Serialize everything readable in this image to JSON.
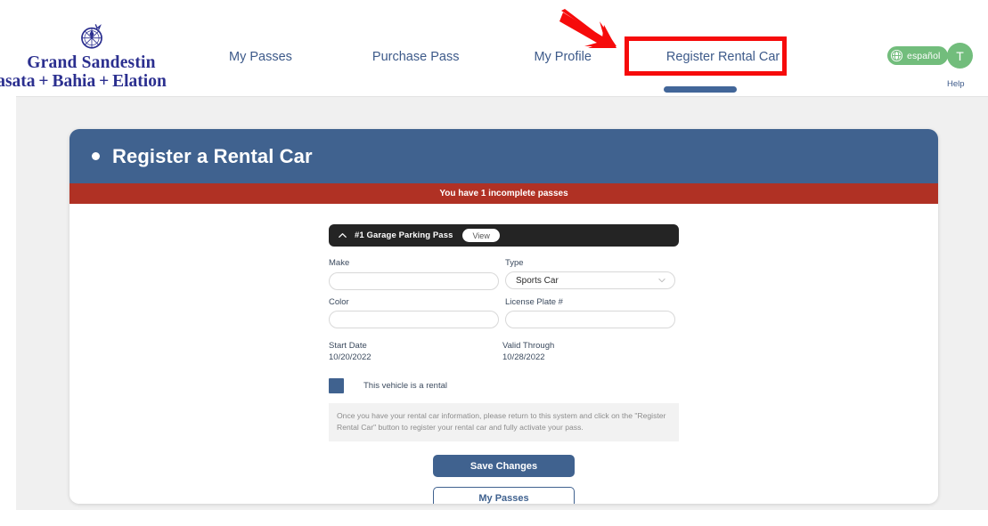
{
  "brand": {
    "line1": "Grand Sandestin",
    "line2": "asata + Bahia + Elation",
    "logo_icon": "compass-rose-icon",
    "color": "#2b2f8f"
  },
  "nav": {
    "items": [
      {
        "label": "My Passes",
        "highlighted": false
      },
      {
        "label": "Purchase Pass",
        "highlighted": false
      },
      {
        "label": "My Profile",
        "highlighted": false
      },
      {
        "label": "Register Rental Car",
        "highlighted": true
      }
    ],
    "text_color": "#3d5a8a"
  },
  "annotations": {
    "box_color": "#f60b0b",
    "arrow_color": "#f60b0b",
    "arrow_icon": "red-arrow-pointing-down-right",
    "target": "Register Rental Car"
  },
  "header_controls": {
    "language": {
      "label": "español",
      "icon": "globe-icon",
      "bg": "#72bd7c"
    },
    "avatar": {
      "initial": "T",
      "bg": "#72bd7c"
    },
    "help": {
      "label": "Help"
    }
  },
  "scroll_indicator": {
    "name": "horizontal-scrollbar",
    "color": "#426699"
  },
  "card": {
    "header": {
      "title": "Register a Rental Car",
      "bullet_icon": "dot-icon",
      "bg": "#40628f"
    },
    "alert": {
      "text": "You have 1 incomplete passes",
      "bg": "#b03124"
    }
  },
  "pass": {
    "chevron_icon": "chevron-up-icon",
    "title": "#1 Garage Parking Pass",
    "view_label": "View",
    "bg": "#242424"
  },
  "form": {
    "fields": [
      {
        "label": "Make",
        "value": "",
        "placeholder": "",
        "type": "text",
        "name": "make-input"
      },
      {
        "label": "Type",
        "value": "Sports Car",
        "placeholder": "",
        "type": "select",
        "name": "type-select"
      },
      {
        "label": "Color",
        "value": "",
        "placeholder": "",
        "type": "text",
        "name": "color-input"
      },
      {
        "label": "License Plate #",
        "value": "",
        "placeholder": "",
        "type": "text",
        "name": "license-plate-input"
      }
    ],
    "dates": [
      {
        "label": "Start Date",
        "value": "10/20/2022"
      },
      {
        "label": "Valid Through",
        "value": "10/28/2022"
      }
    ],
    "rental_checkbox": {
      "label": "This vehicle is a rental",
      "checked": true,
      "color": "#40628f"
    },
    "info_text": "Once you have your rental car information, please return to this system and click on the \"Register Rental Car\" button to register your rental car and fully activate your pass.",
    "buttons": {
      "primary": "Save Changes",
      "secondary": "My Passes"
    }
  }
}
